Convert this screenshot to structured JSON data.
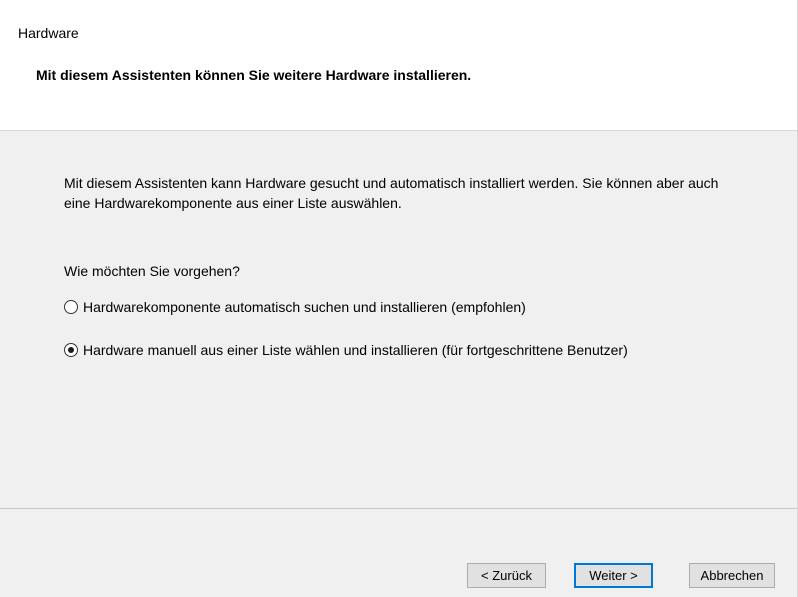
{
  "header": {
    "crumb": "Hardware",
    "heading": "Mit diesem Assistenten können Sie weitere Hardware installieren."
  },
  "body": {
    "intro": "Mit diesem Assistenten kann Hardware gesucht und automatisch installiert werden. Sie können aber auch eine Hardwarekomponente aus einer Liste auswählen.",
    "question": "Wie möchten Sie vorgehen?",
    "options": [
      {
        "label": "Hardwarekomponente automatisch suchen und installieren (empfohlen)",
        "checked": false
      },
      {
        "label": "Hardware manuell aus einer Liste wählen und installieren (für fortgeschrittene Benutzer)",
        "checked": true
      }
    ]
  },
  "footer": {
    "back_label": "< Zurück",
    "next_label": "Weiter >",
    "cancel_label": "Abbrechen"
  },
  "colors": {
    "default_button_border": "#0078d7",
    "body_background": "#f0f0f0"
  }
}
